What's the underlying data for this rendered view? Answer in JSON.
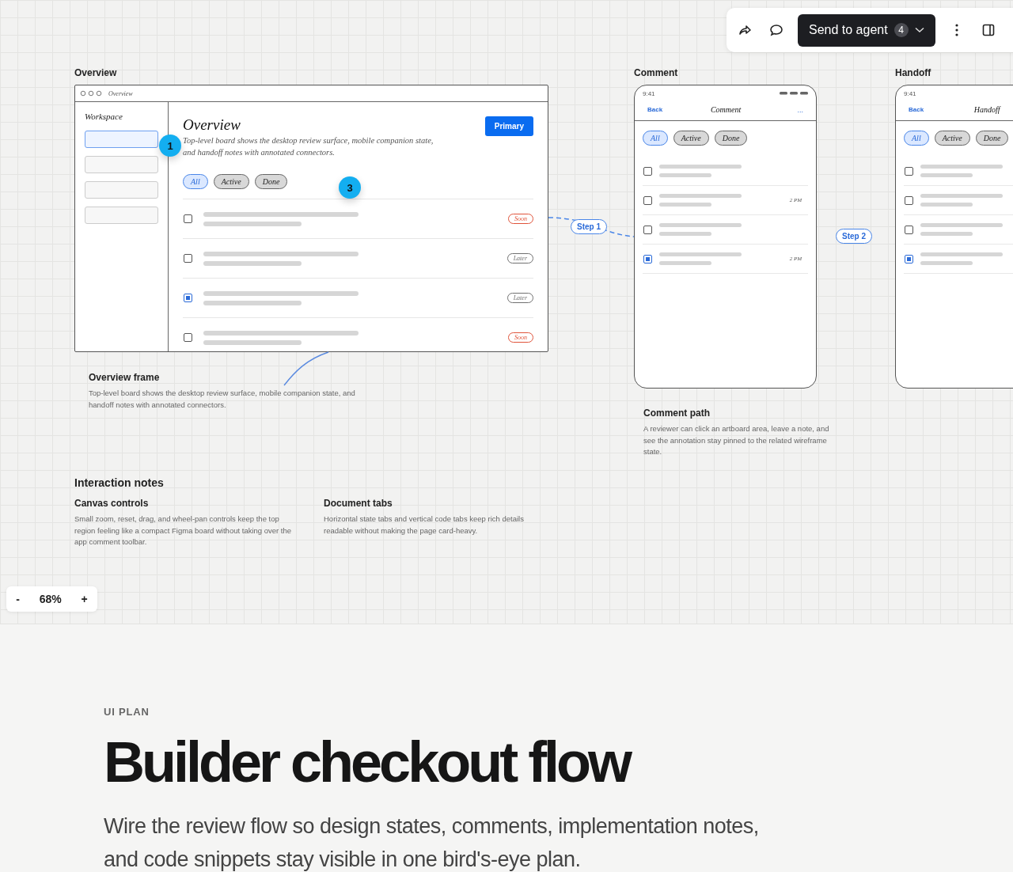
{
  "toolbar": {
    "send_label": "Send to agent",
    "badge": "4"
  },
  "desktop": {
    "label": "Overview",
    "window_title": "Overview",
    "sidebar_title": "Workspace",
    "sidebar_items": [
      {
        "selected": true
      },
      {
        "selected": false
      },
      {
        "selected": false
      },
      {
        "selected": false
      }
    ],
    "heading": "Overview",
    "description": "Top-level board shows the desktop review surface, mobile companion state, and handoff notes with annotated connectors.",
    "primary": "Primary",
    "filters": [
      {
        "label": "All",
        "selected": true
      },
      {
        "label": "Active",
        "selected": false
      },
      {
        "label": "Done",
        "selected": false
      }
    ],
    "rows": [
      {
        "checked": false,
        "tag": "Soon",
        "color": "#e0533a"
      },
      {
        "checked": false,
        "tag": "Later",
        "color": "#707070"
      },
      {
        "checked": true,
        "tag": "Later",
        "color": "#707070"
      },
      {
        "checked": false,
        "tag": "Soon",
        "color": "#e0533a"
      }
    ]
  },
  "pins": [
    "1",
    "3"
  ],
  "steps": [
    "Step 1",
    "Step 2"
  ],
  "phones": [
    {
      "label": "Comment",
      "time": "9:41",
      "back": "Back",
      "title": "Comment",
      "more": "...",
      "filters": [
        {
          "label": "All",
          "selected": true
        },
        {
          "label": "Active",
          "selected": false
        },
        {
          "label": "Done",
          "selected": false
        }
      ],
      "rows": [
        {
          "checked": false
        },
        {
          "checked": false,
          "time": "2 PM"
        },
        {
          "checked": false
        },
        {
          "checked": true,
          "time": "2 PM"
        }
      ]
    },
    {
      "label": "Handoff",
      "time": "9:41",
      "back": "Back",
      "title": "Handoff",
      "filters": [
        {
          "label": "All",
          "selected": true
        },
        {
          "label": "Active",
          "selected": false
        },
        {
          "label": "Done",
          "selected": false
        }
      ],
      "rows": [
        {
          "checked": false
        },
        {
          "checked": false
        },
        {
          "checked": false
        },
        {
          "checked": true
        }
      ]
    }
  ],
  "notes": [
    {
      "title": "Overview frame",
      "text": "Top-level board shows the desktop review surface, mobile companion state, and handoff notes with annotated connectors."
    },
    {
      "title": "Comment path",
      "text": "A reviewer can click an artboard area, leave a note, and see the annotation stay pinned to the related wireframe state."
    }
  ],
  "interaction_notes": {
    "title": "Interaction notes",
    "items": [
      {
        "title": "Canvas controls",
        "text": "Small zoom, reset, drag, and wheel-pan controls keep the top region feeling like a compact Figma board without taking over the app comment toolbar."
      },
      {
        "title": "Document tabs",
        "text": "Horizontal state tabs and vertical code tabs keep rich details readable without making the page card-heavy."
      }
    ]
  },
  "zoom": {
    "minus": "-",
    "value": "68%",
    "plus": "+"
  },
  "plan": {
    "eyebrow": "UI PLAN",
    "title": "Builder checkout flow",
    "lead": "Wire the review flow so design states, comments, implementation notes, and code snippets stay visible in one bird's-eye plan."
  }
}
